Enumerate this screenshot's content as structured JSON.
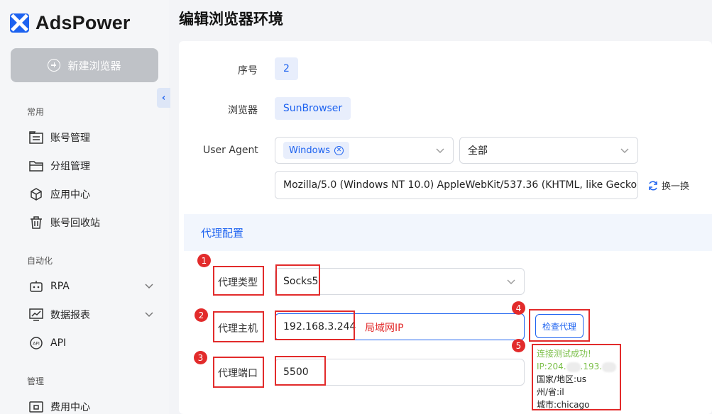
{
  "app": {
    "brand": "AdsPower",
    "page_title": "编辑浏览器环境"
  },
  "sidebar": {
    "new_browser_label": "新建浏览器",
    "sections": [
      {
        "label": "常用",
        "items": [
          "账号管理",
          "分组管理",
          "应用中心",
          "账号回收站"
        ]
      },
      {
        "label": "自动化",
        "items": [
          "RPA",
          "数据报表",
          "API"
        ]
      },
      {
        "label": "管理",
        "items": [
          "费用中心"
        ]
      }
    ]
  },
  "form": {
    "serial_label": "序号",
    "serial_value": "2",
    "browser_label": "浏览器",
    "browser_value": "SunBrowser",
    "ua_label": "User Agent",
    "ua_os_chip": "Windows",
    "ua_version_select": "全部",
    "ua_string": "Mozilla/5.0 (Windows NT 10.0) AppleWebKit/537.36 (KHTML, like Gecko",
    "ua_swap_label": "换一换"
  },
  "proxy": {
    "section_title": "代理配置",
    "type_label": "代理类型",
    "type_value": "Socks5",
    "host_label": "代理主机",
    "host_value": "192.168.3.244",
    "host_note": "局域网IP",
    "port_label": "代理端口",
    "port_value": "5500",
    "check_button": "检查代理",
    "result": {
      "status": "连接测试成功!",
      "ip_prefix": "IP:204.",
      "ip_mid": ".193.",
      "country": "国家/地区:us",
      "state": "州/省:il",
      "city": "城市:chicago"
    }
  },
  "annotations": [
    "1",
    "2",
    "3",
    "4",
    "5"
  ],
  "colors": {
    "accent": "#1e63f0",
    "annotation_red": "#e22b2b",
    "success": "#7cc04a"
  }
}
